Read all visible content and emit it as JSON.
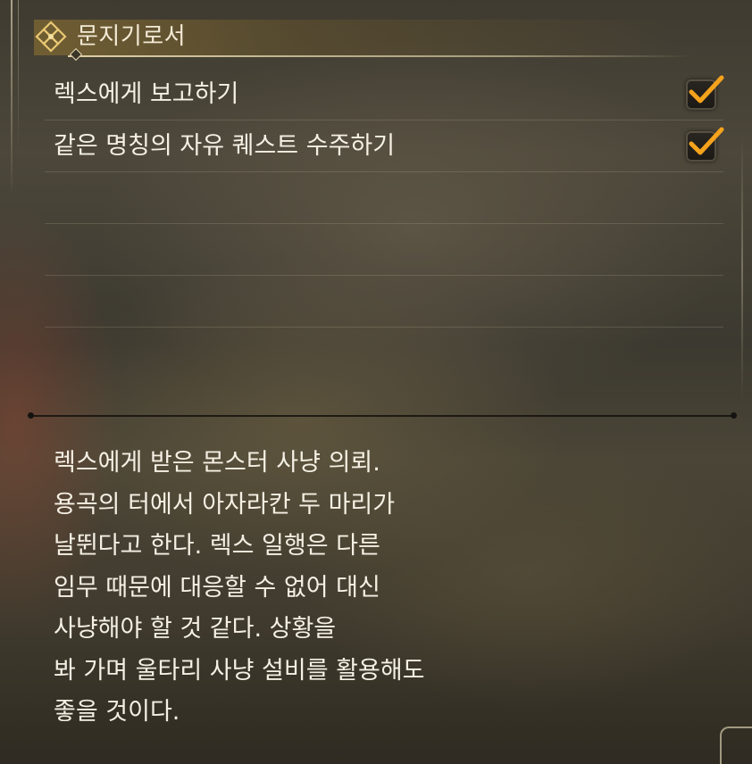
{
  "header": {
    "title": "문지기로서",
    "icon": "ornament-diamond-icon"
  },
  "objectives": [
    {
      "label": "렉스에게 보고하기",
      "completed": true
    },
    {
      "label": "같은 명칭의 자유 퀘스트 수주하기",
      "completed": true
    }
  ],
  "description": {
    "lines": [
      "렉스에게 받은 몬스터 사냥 의뢰.",
      "용곡의 터에서 아자라칸 두 마리가",
      "날뛴다고 한다. 렉스 일행은 다른",
      "임무 때문에 대응할 수 없어 대신",
      "사냥해야 할 것 같다. 상황을",
      "봐 가며 울타리 사냥 설비를 활용해도",
      "좋을 것이다."
    ]
  },
  "colors": {
    "accent": "#f5a21c",
    "text": "#f5f0e4",
    "header_gold": "#9a7a34"
  }
}
